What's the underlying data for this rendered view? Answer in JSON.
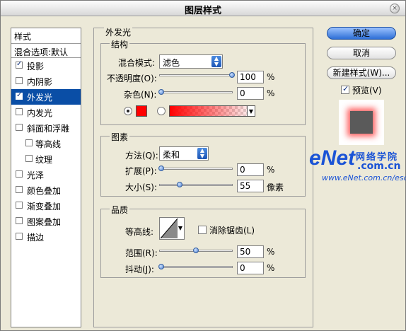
{
  "window": {
    "title": "图层样式",
    "close": "×"
  },
  "styles_list": {
    "header": "样式",
    "blend_options": "混合选项:默认",
    "items": [
      {
        "label": "投影",
        "checked": true
      },
      {
        "label": "内阴影",
        "checked": false
      },
      {
        "label": "外发光",
        "checked": true,
        "selected": true
      },
      {
        "label": "内发光",
        "checked": false
      },
      {
        "label": "斜面和浮雕",
        "checked": false
      },
      {
        "label": "等高线",
        "checked": false,
        "indent": true
      },
      {
        "label": "纹理",
        "checked": false,
        "indent": true
      },
      {
        "label": "光泽",
        "checked": false
      },
      {
        "label": "颜色叠加",
        "checked": false
      },
      {
        "label": "渐变叠加",
        "checked": false
      },
      {
        "label": "图案叠加",
        "checked": false
      },
      {
        "label": "描边",
        "checked": false
      }
    ]
  },
  "outer_glow": {
    "title": "外发光",
    "structure": {
      "title": "结构",
      "blend_mode_label": "混合模式:",
      "blend_mode_value": "滤色",
      "opacity_label": "不透明度(O):",
      "opacity_value": "100",
      "opacity_unit": "%",
      "noise_label": "杂色(N):",
      "noise_value": "0",
      "noise_unit": "%",
      "color": "#ff0000"
    },
    "elements": {
      "title": "图素",
      "method_label": "方法(Q):",
      "method_value": "柔和",
      "spread_label": "扩展(P):",
      "spread_value": "0",
      "spread_unit": "%",
      "size_label": "大小(S):",
      "size_value": "55",
      "size_unit": "像素"
    },
    "quality": {
      "title": "品质",
      "contour_label": "等高线:",
      "antialias_label": "消除锯齿(L)",
      "range_label": "范围(R):",
      "range_value": "50",
      "range_unit": "%",
      "jitter_label": "抖动(J):",
      "jitter_value": "0",
      "jitter_unit": "%"
    }
  },
  "buttons": {
    "ok": "确定",
    "cancel": "取消",
    "new_style": "新建样式(W)...",
    "preview_label": "预览(V)"
  },
  "watermark": {
    "brand": "eNet",
    "cn_text": "网络学院",
    "dot": ".com.cn",
    "url": "www.eNet.com.cn/eschool"
  }
}
